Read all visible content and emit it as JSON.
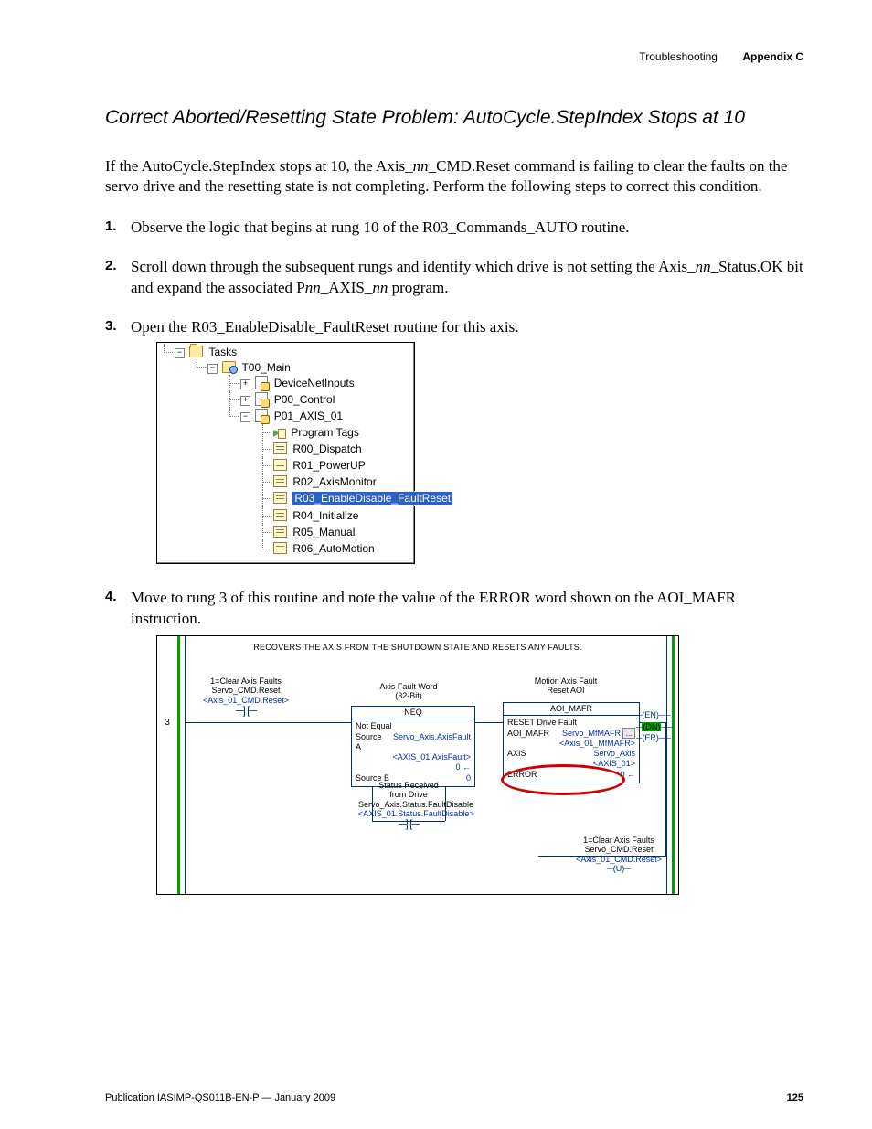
{
  "header": {
    "left": "Troubleshooting",
    "right": "Appendix C"
  },
  "section_title": "Correct Aborted/Resetting State Problem: AutoCycle.StepIndex Stops at 10",
  "intro": {
    "pre": "If the AutoCycle.StepIndex stops at 10, the Axis_",
    "nn1": "nn",
    "post": "_CMD.Reset command is failing to clear the faults on the servo drive and the resetting state is not completing. Perform the following steps to correct this condition."
  },
  "steps": {
    "s1": "Observe the logic that begins at rung 10 of the R03_Commands_AUTO routine.",
    "s2a": "Scroll down through the subsequent rungs and identify which drive is not setting the Axis_",
    "s2_nn1": "nn",
    "s2b": "_Status.OK bit and expand the associated P",
    "s2_nn2": "nn",
    "s2c": "_AXIS_",
    "s2_nn3": "nn",
    "s2d": " program.",
    "s3": "Open the R03_EnableDisable_FaultReset routine for this axis.",
    "s4": "Move to rung 3 of this routine and note the value of the ERROR word shown on the AOI_MAFR instruction."
  },
  "tree": {
    "root": "Tasks",
    "main": "T00_Main",
    "devnet": "DeviceNetInputs",
    "p00": "P00_Control",
    "p01": "P01_AXIS_01",
    "items": {
      "tags": "Program Tags",
      "r00": "R00_Dispatch",
      "r01": "R01_PowerUP",
      "r02": "R02_AxisMonitor",
      "r03": "R03_EnableDisable_FaultReset",
      "r04": "R04_Initialize",
      "r05": "R05_Manual",
      "r06": "R06_AutoMotion"
    }
  },
  "ladder": {
    "banner": "RECOVERS THE AXIS FROM THE SHUTDOWN STATE AND RESETS ANY FAULTS.",
    "rung_num": "3",
    "xic1": {
      "t1": "1=Clear Axis Faults",
      "t2": "Servo_CMD.Reset",
      "t3": "<Axis_01_CMD.Reset>"
    },
    "neq": {
      "title1": "Axis Fault Word",
      "title2": "(32-Bit)",
      "hdr": "NEQ",
      "name": "Not Equal",
      "r1a": "Source A",
      "r1b": "Servo_Axis.AxisFault",
      "r1c": "<AXIS_01.AxisFault>",
      "r1d": "0",
      "r2a": "Source B",
      "r2b": "0"
    },
    "xic2": {
      "t1": "Status Received",
      "t2": "from Drive",
      "t3": "Servo_Axis.Status.FaultDisable",
      "t4": "<AXIS_01.Status.FaultDisable>"
    },
    "mafr": {
      "title1": "Motion Axis Fault",
      "title2": "Reset AOI",
      "hdr": "AOI_MAFR",
      "r0": "RESET Drive Fault",
      "r1a": "AOI_MAFR",
      "r1b": "Servo_MfMAFR",
      "r1btn": "...",
      "r1c": "<Axis_01_MfMAFR>",
      "r2a": "AXIS",
      "r2b": "Servo_Axis",
      "r2c": "<AXIS_01>",
      "r3a": "ERROR",
      "r3b": "0"
    },
    "flags": {
      "en": "(EN)",
      "dn": "(DN)",
      "er": "(ER)"
    },
    "unlatch": {
      "t1": "1=Clear Axis Faults",
      "t2": "Servo_CMD.Reset",
      "t3": "<Axis_01_CMD.Reset>",
      "coil": "(U)"
    }
  },
  "footer": {
    "pub": "Publication IASIMP-QS011B-EN-P — January 2009",
    "page": "125"
  }
}
